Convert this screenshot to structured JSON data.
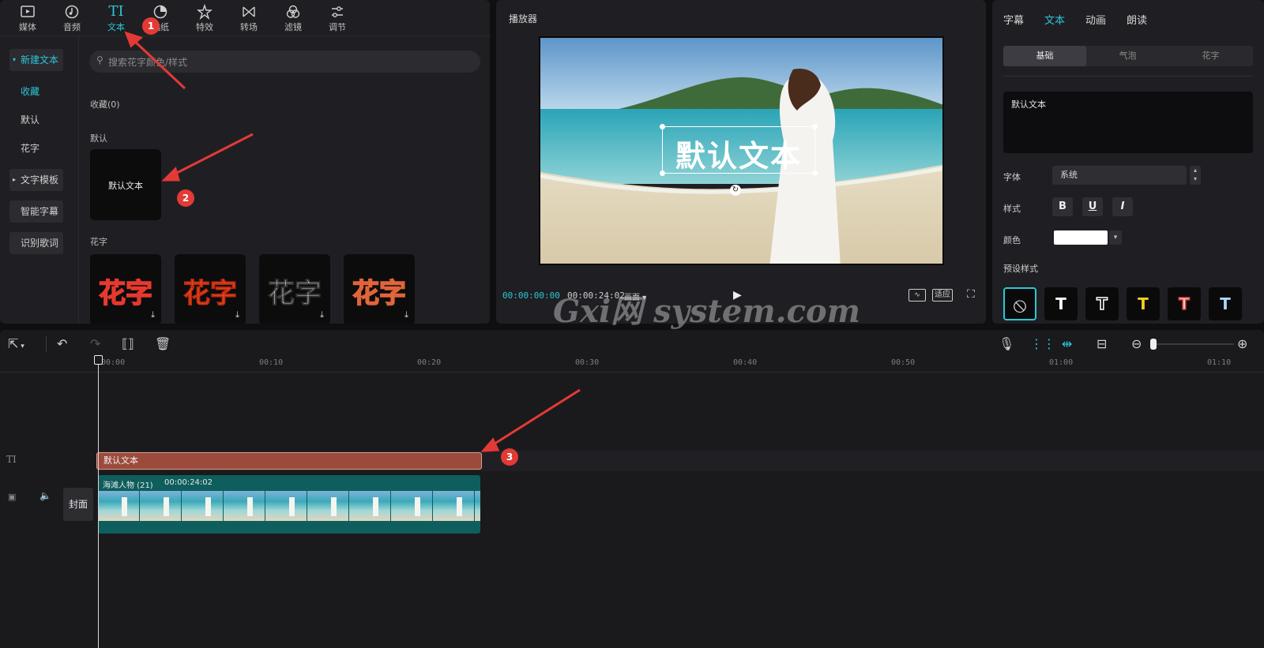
{
  "media_panel": {
    "tabs": [
      {
        "label": "媒体",
        "icon": "media-icon"
      },
      {
        "label": "音频",
        "icon": "audio-icon"
      },
      {
        "label": "文本",
        "icon": "text-icon"
      },
      {
        "label": "贴纸",
        "icon": "sticker-icon"
      },
      {
        "label": "特效",
        "icon": "effects-icon"
      },
      {
        "label": "转场",
        "icon": "transition-icon"
      },
      {
        "label": "滤镜",
        "icon": "filter-icon"
      },
      {
        "label": "调节",
        "icon": "adjust-icon"
      }
    ],
    "sidebar": [
      "新建文本",
      "收藏",
      "默认",
      "花字",
      "文字模板",
      "智能字幕",
      "识别歌词"
    ],
    "search_placeholder": "搜索花字颜色/样式",
    "favorites_label": "收藏(0)",
    "default_section": "默认",
    "default_item": "默认文本",
    "flower_section": "花字",
    "flower_items": [
      "花字",
      "花字",
      "花字",
      "花字"
    ]
  },
  "player": {
    "title": "播放器",
    "overlay_text": "默认文本",
    "current_time": "00:00:00:00",
    "total_time": "00:00:24:02",
    "ratio_label": "画面",
    "fit_label": "适应"
  },
  "inspector": {
    "tabs": [
      "字幕",
      "文本",
      "动画",
      "朗读"
    ],
    "subtabs": [
      "基础",
      "气泡",
      "花字"
    ],
    "text_value": "默认文本",
    "font_label": "字体",
    "font_value": "系统",
    "style_label": "样式",
    "style_buttons": [
      "B",
      "U",
      "I"
    ],
    "color_label": "颜色",
    "preset_label": "预设样式",
    "presets": [
      "T",
      "T",
      "T",
      "T",
      "T"
    ]
  },
  "timeline": {
    "ruler_labels": [
      "00:00",
      "00:10",
      "00:20",
      "00:30",
      "00:40",
      "00:50",
      "01:00",
      "01:10"
    ],
    "text_track_icon": "TI",
    "text_clip_label": "默认文本",
    "video_clip_name": "海滩人物 (21)",
    "video_clip_duration": "00:00:24:02",
    "cover_label": "封面"
  },
  "annotations": [
    "1",
    "2",
    "3"
  ],
  "watermark": "Gxi网 system.com",
  "colors": {
    "accent": "#2dc6d6",
    "text_clip": "#9c4a3b",
    "video_clip": "#0f5e5e",
    "marker": "#e23a36"
  }
}
